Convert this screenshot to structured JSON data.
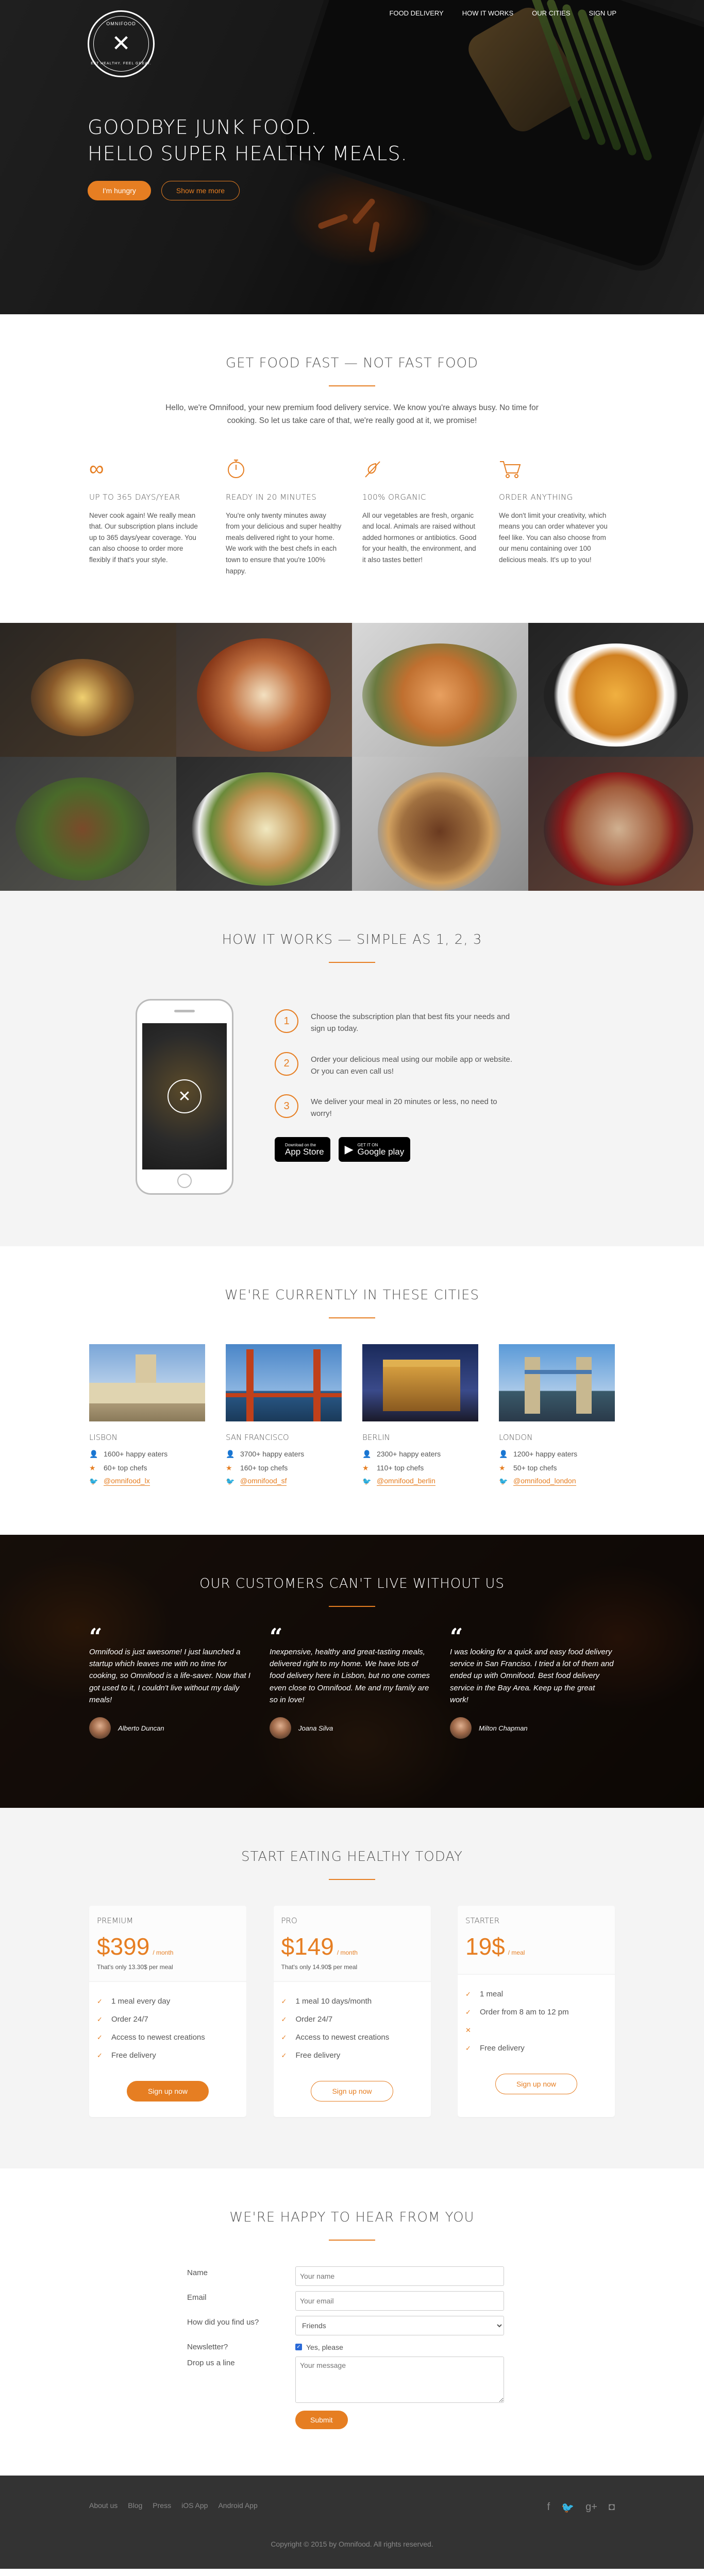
{
  "brand": {
    "logo_top": "OMNIFOOD",
    "logo_bottom": "EAT HEALTHY. FEEL GREAT.",
    "accent": "#e67e22"
  },
  "nav": [
    {
      "label": "Food delivery"
    },
    {
      "label": "How it works"
    },
    {
      "label": "Our cities"
    },
    {
      "label": "Sign up"
    }
  ],
  "hero": {
    "line1": "Goodbye junk food.",
    "line2": "Hello super healthy meals.",
    "btn_primary": "I'm hungry",
    "btn_secondary": "Show me more"
  },
  "features": {
    "title": "Get food fast — not fast food",
    "lead": "Hello, we're Omnifood, your new premium food delivery service. We know you're always busy. No time for cooking. So let us take care of that, we're really good at it, we promise!",
    "items": [
      {
        "icon": "infinity-icon",
        "title": "Up to 365 days/year",
        "text": "Never cook again! We really mean that. Our subscription plans include up to 365 days/year coverage. You can also choose to order more flexibly if that's your style."
      },
      {
        "icon": "stopwatch-icon",
        "title": "Ready in 20 minutes",
        "text": "You're only twenty minutes away from your delicious and super healthy meals delivered right to your home. We work with the best chefs in each town to ensure that you're 100% happy."
      },
      {
        "icon": "leaf-icon",
        "title": "100% organic",
        "text": "All our vegetables are fresh, organic and local. Animals are raised without added hormones or antibiotics. Good for your health, the environment, and it also tastes better!"
      },
      {
        "icon": "cart-icon",
        "title": "Order anything",
        "text": "We don't limit your creativity, which means you can order whatever you feel like. You can also choose from our menu containing over 100 delicious meals. It's up to you!"
      }
    ]
  },
  "steps": {
    "title": "How it works — Simple as 1, 2, 3",
    "items": [
      {
        "num": "1",
        "text": "Choose the subscription plan that best fits your needs and sign up today."
      },
      {
        "num": "2",
        "text": "Order your delicious meal using our mobile app or website. Or you can even call us!"
      },
      {
        "num": "3",
        "text": "We deliver your meal in 20 minutes or less, no need to worry!"
      }
    ],
    "appstore": {
      "small": "Download on the",
      "big": "App Store"
    },
    "googleplay": {
      "small": "GET IT ON",
      "big": "Google play"
    }
  },
  "cities": {
    "title": "We're currently in these cities",
    "items": [
      {
        "name": "Lisbon",
        "eaters": "1600+ happy eaters",
        "chefs": "60+ top chefs",
        "twitter": "@omnifood_lx"
      },
      {
        "name": "San Francisco",
        "eaters": "3700+ happy eaters",
        "chefs": "160+ top chefs",
        "twitter": "@omnifood_sf"
      },
      {
        "name": "Berlin",
        "eaters": "2300+ happy eaters",
        "chefs": "110+ top chefs",
        "twitter": "@omnifood_berlin"
      },
      {
        "name": "London",
        "eaters": "1200+ happy eaters",
        "chefs": "50+ top chefs",
        "twitter": "@omnifood_london"
      }
    ]
  },
  "testimonials": {
    "title": "Our customers can't live without us",
    "items": [
      {
        "quote": "Omnifood is just awesome! I just launched a startup which leaves me with no time for cooking, so Omnifood is a life-saver. Now that I got used to it, I couldn't live without my daily meals!",
        "name": "Alberto Duncan"
      },
      {
        "quote": "Inexpensive, healthy and great-tasting meals, delivered right to my home. We have lots of food delivery here in Lisbon, but no one comes even close to Omnifood. Me and my family are so in love!",
        "name": "Joana Silva"
      },
      {
        "quote": "I was looking for a quick and easy food delivery service in San Franciso. I tried a lot of them and ended up with Omnifood. Best food delivery service in the Bay Area. Keep up the great work!",
        "name": "Milton Chapman"
      }
    ]
  },
  "plans": {
    "title": "Start eating healthy today",
    "items": [
      {
        "name": "Premium",
        "price": "$399",
        "per": "/ month",
        "sub": "That's only 13.30$ per meal",
        "features": [
          "1 meal every day",
          "Order 24/7",
          "Access to newest creations",
          "Free delivery"
        ],
        "cta": "Sign up now",
        "cta_style": "full"
      },
      {
        "name": "Pro",
        "price": "$149",
        "per": "/ month",
        "sub": "That's only 14.90$ per meal",
        "features": [
          "1 meal 10 days/month",
          "Order 24/7",
          "Access to newest creations",
          "Free delivery"
        ],
        "cta": "Sign up now",
        "cta_style": "ghost"
      },
      {
        "name": "Starter",
        "price": "19$",
        "per": "/ meal",
        "sub": "",
        "features": [
          "1 meal",
          "Order from 8 am to 12 pm",
          "",
          "Free delivery"
        ],
        "cta": "Sign up now",
        "cta_style": "ghost"
      }
    ]
  },
  "form": {
    "title": "We're happy to hear from you",
    "name_label": "Name",
    "name_placeholder": "Your name",
    "email_label": "Email",
    "email_placeholder": "Your email",
    "find_label": "How did you find us?",
    "find_value": "Friends",
    "news_label": "Newsletter?",
    "news_value": "Yes, please",
    "msg_label": "Drop us a line",
    "msg_placeholder": "Your message",
    "submit": "Submit"
  },
  "footer": {
    "links": [
      "About us",
      "Blog",
      "Press",
      "iOS App",
      "Android App"
    ],
    "social": [
      "facebook-icon",
      "twitter-icon",
      "googleplus-icon",
      "instagram-icon"
    ],
    "copyright": "Copyright © 2015 by Omnifood. All rights reserved."
  }
}
